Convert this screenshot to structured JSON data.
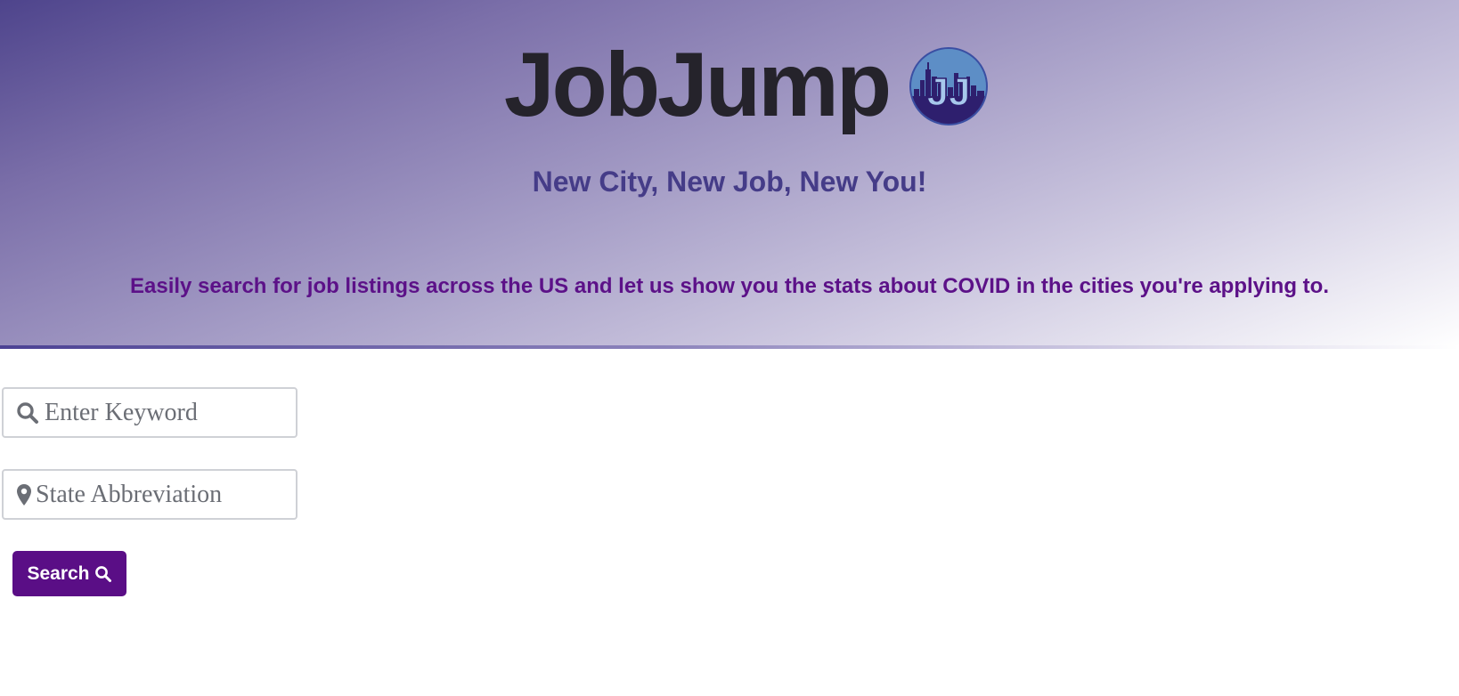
{
  "header": {
    "brand_name": "JobJump",
    "logo_monogram": "JJ",
    "tagline": "New City, New Job, New You!",
    "description": "Easily search for job listings across the US and let us show you the stats about COVID in the cities you're applying to."
  },
  "search_form": {
    "keyword_placeholder": "Enter Keyword",
    "keyword_value": "",
    "keyword_icon": "search-icon",
    "state_placeholder": "State Abbreviation",
    "state_value": "",
    "state_icon": "map-marker-icon",
    "button_label": "Search",
    "button_icon": "search-icon"
  },
  "colors": {
    "accent": "#5a0e86",
    "tagline": "#453c88",
    "description": "#5c1188",
    "title": "#25232b",
    "logo_fill": "#5d8ec6",
    "logo_skyline": "#2e1f6e"
  }
}
